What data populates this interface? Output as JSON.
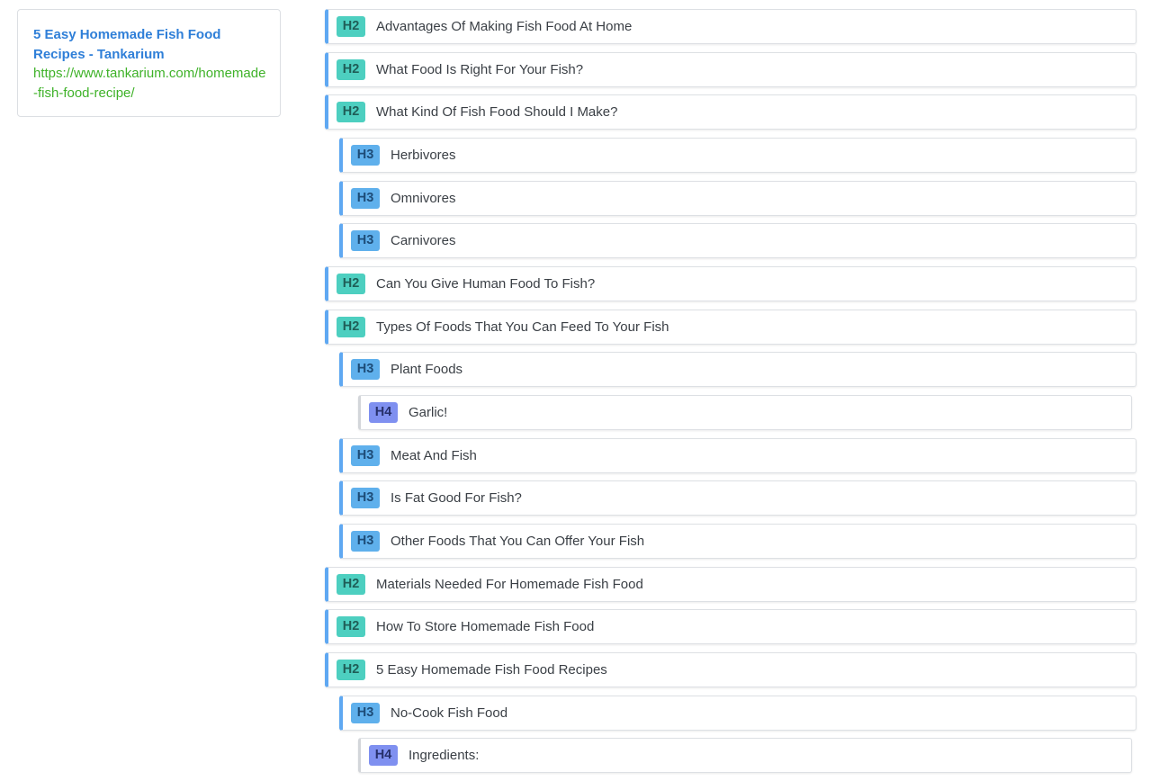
{
  "source": {
    "title": "5 Easy Homemade Fish Food Recipes - Tankarium",
    "url": "https://www.tankarium.com/homemade-fish-food-recipe/"
  },
  "colors": {
    "h2_tag": "#4dcfc0",
    "h3_tag": "#5fb0ec",
    "h4_tag": "#7f90f0",
    "accent_border": "#5fa8f2",
    "title_link": "#2f7fd8",
    "url_link": "#3fb229"
  },
  "headings": [
    {
      "level": "H2",
      "text": "Advantages Of Making Fish Food At Home"
    },
    {
      "level": "H2",
      "text": "What Food Is Right For Your Fish?"
    },
    {
      "level": "H2",
      "text": "What Kind Of Fish Food Should I Make?"
    },
    {
      "level": "H3",
      "text": "Herbivores"
    },
    {
      "level": "H3",
      "text": "Omnivores"
    },
    {
      "level": "H3",
      "text": "Carnivores"
    },
    {
      "level": "H2",
      "text": "Can You Give Human Food To Fish?"
    },
    {
      "level": "H2",
      "text": "Types Of Foods That You Can Feed To Your Fish"
    },
    {
      "level": "H3",
      "text": "Plant Foods"
    },
    {
      "level": "H4",
      "text": "Garlic!"
    },
    {
      "level": "H3",
      "text": "Meat And Fish"
    },
    {
      "level": "H3",
      "text": "Is Fat Good For Fish?"
    },
    {
      "level": "H3",
      "text": "Other Foods That You Can Offer Your Fish"
    },
    {
      "level": "H2",
      "text": "Materials Needed For Homemade Fish Food"
    },
    {
      "level": "H2",
      "text": "How To Store Homemade Fish Food"
    },
    {
      "level": "H2",
      "text": "5 Easy Homemade Fish Food Recipes"
    },
    {
      "level": "H3",
      "text": "No-Cook Fish Food"
    },
    {
      "level": "H4",
      "text": "Ingredients:"
    }
  ]
}
